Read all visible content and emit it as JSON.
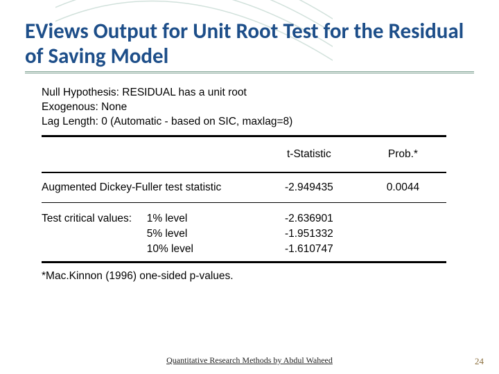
{
  "title": "EViews Output for Unit Root Test for the Residual of Saving Model",
  "spec": {
    "null_hypothesis": "Null Hypothesis: RESIDUAL has a unit root",
    "exogenous": "Exogenous: None",
    "lag_length": "Lag Length: 0 (Automatic - based on SIC, maxlag=8)"
  },
  "headers": {
    "tstat": "t-Statistic",
    "prob": "Prob.*"
  },
  "adf": {
    "label": "Augmented Dickey-Fuller test statistic",
    "tstat": "-2.949435",
    "prob": "0.0044"
  },
  "critical": {
    "label": "Test critical values:",
    "levels": [
      {
        "level": "1% level",
        "value": "-2.636901"
      },
      {
        "level": "5% level",
        "value": "-1.951332"
      },
      {
        "level": "10% level",
        "value": "-1.610747"
      }
    ]
  },
  "note": "*Mac.Kinnon (1996) one-sided p-values.",
  "footer": "Quantitative Research Methods by Abdul Waheed",
  "page": "24"
}
